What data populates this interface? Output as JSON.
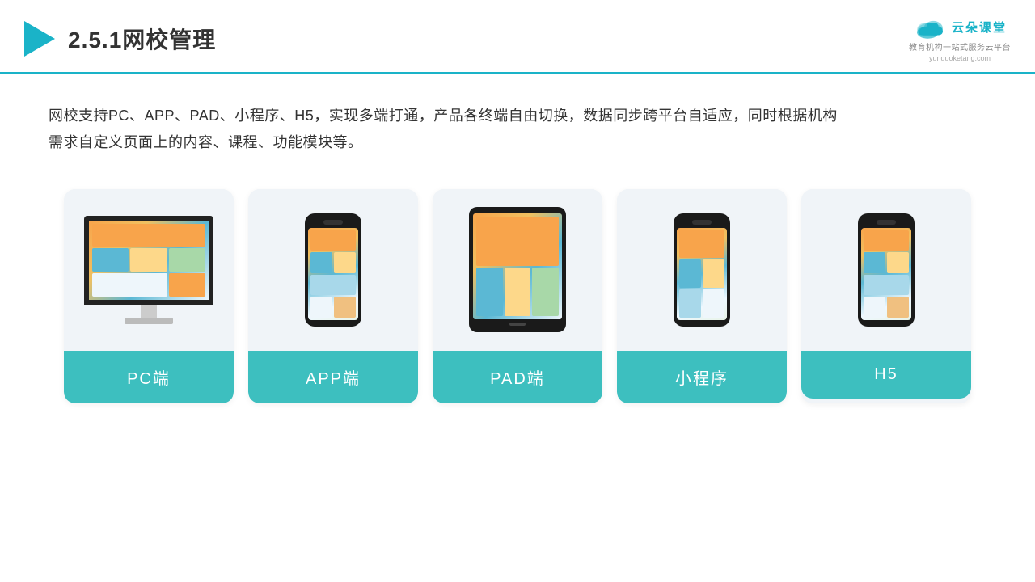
{
  "header": {
    "title": "2.5.1网校管理",
    "logo_text": "云朵课堂",
    "logo_sub": "教育机构一站\n式服务云平台",
    "logo_url": "yunduoketang.com"
  },
  "description": {
    "line1": "网校支持PC、APP、PAD、小程序、H5，实现多端打通，产品各终端自由切换，数据同步跨平台自适应，同时根据机构",
    "line2": "需求自定义页面上的内容、课程、功能模块等。"
  },
  "cards": [
    {
      "label": "PC端",
      "type": "pc"
    },
    {
      "label": "APP端",
      "type": "phone"
    },
    {
      "label": "PAD端",
      "type": "tablet"
    },
    {
      "label": "小程序",
      "type": "phone"
    },
    {
      "label": "H5",
      "type": "phone"
    }
  ],
  "colors": {
    "teal": "#3dbfbf",
    "blue_accent": "#1ab3c8",
    "bg_card": "#f0f4f8",
    "text_dark": "#333333"
  }
}
